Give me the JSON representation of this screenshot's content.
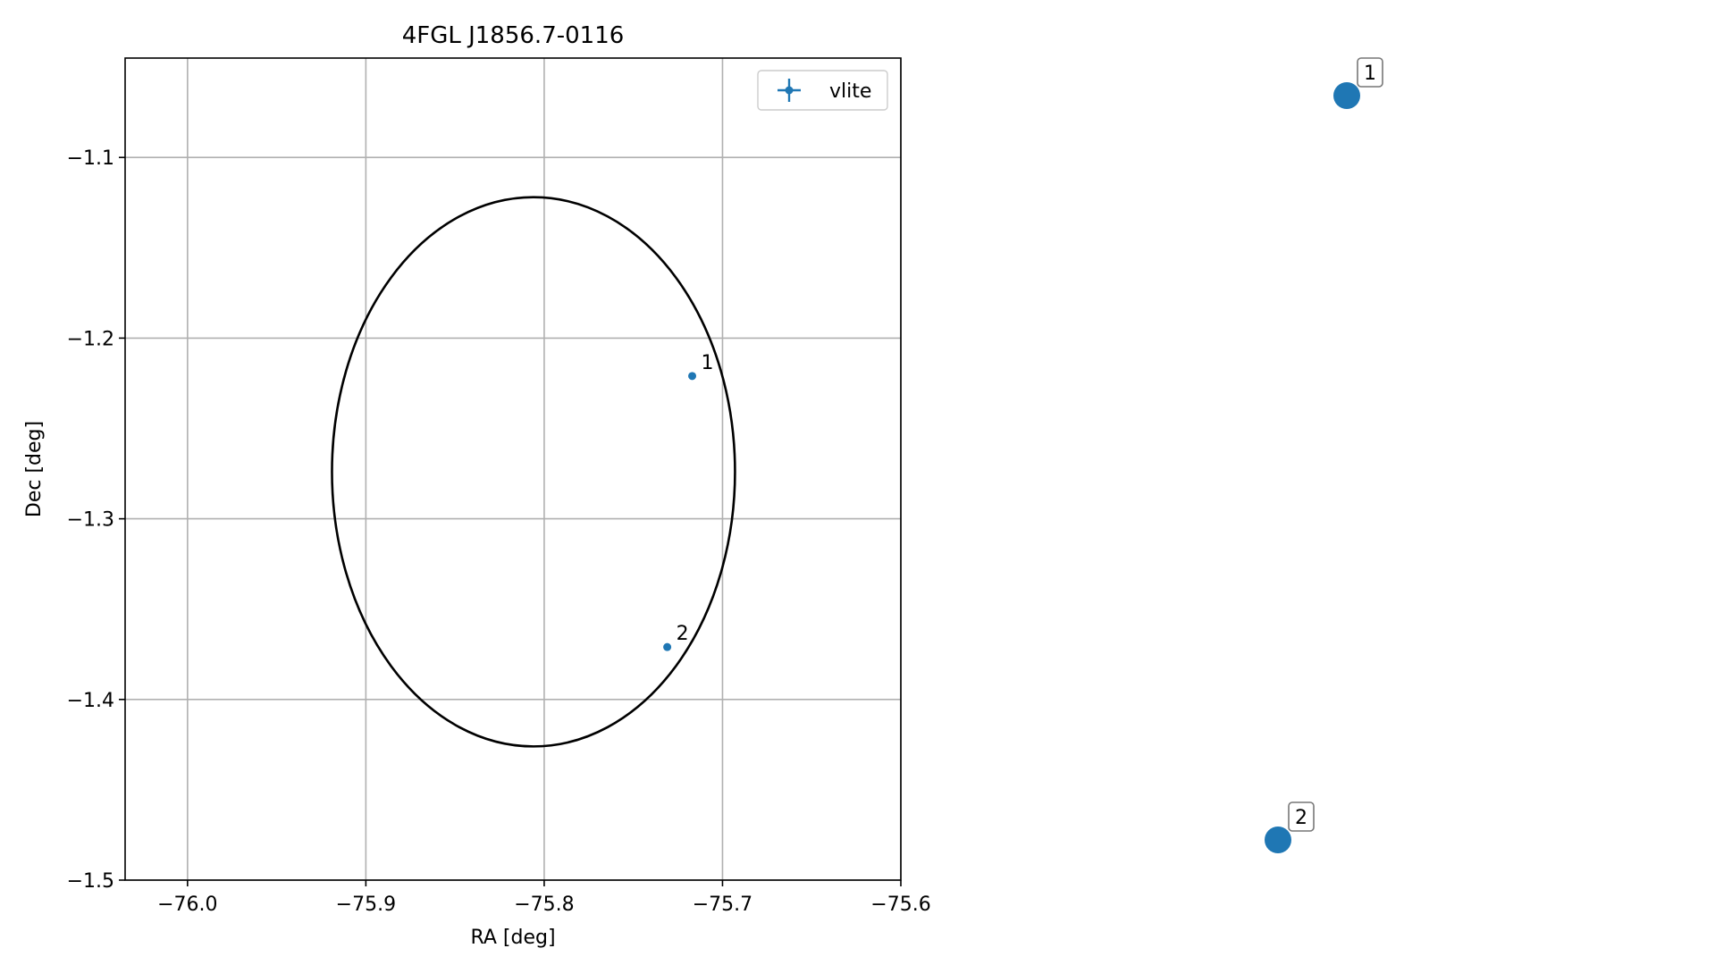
{
  "chart_data": [
    {
      "type": "scatter",
      "title": "4FGL J1856.7-0116",
      "xlabel": "RA [deg]",
      "ylabel": "Dec [deg]",
      "xlim": [
        -76.035,
        -75.6
      ],
      "ylim": [
        -1.5,
        -1.045
      ],
      "x_ticks": [
        -76.0,
        -75.9,
        -75.8,
        -75.7,
        -75.6
      ],
      "x_tick_labels": [
        "−76.0",
        "−75.9",
        "−75.8",
        "−75.7",
        "−75.6"
      ],
      "y_ticks": [
        -1.1,
        -1.2,
        -1.3,
        -1.4,
        -1.5
      ],
      "y_tick_labels": [
        "−1.1",
        "−1.2",
        "−1.3",
        "−1.4",
        "−1.5"
      ],
      "grid": true,
      "legend": {
        "placement": "top-right",
        "entries": [
          "vlite"
        ]
      },
      "series": [
        {
          "name": "vlite",
          "color": "#1f77b4",
          "points": [
            {
              "label": "1",
              "x": -75.717,
              "y": -1.221
            },
            {
              "label": "2",
              "x": -75.731,
              "y": -1.371
            }
          ]
        }
      ],
      "ellipse": {
        "color": "#000000",
        "center": [
          -75.806,
          -1.274
        ],
        "semi_axis_ra": 0.113,
        "semi_axis_dec": 0.152
      }
    },
    {
      "type": "scatter",
      "color": "#1f77b4",
      "points": [
        {
          "label": "1",
          "x": 1,
          "y": 1
        },
        {
          "label": "2",
          "x": 0,
          "y": 0
        }
      ]
    }
  ]
}
